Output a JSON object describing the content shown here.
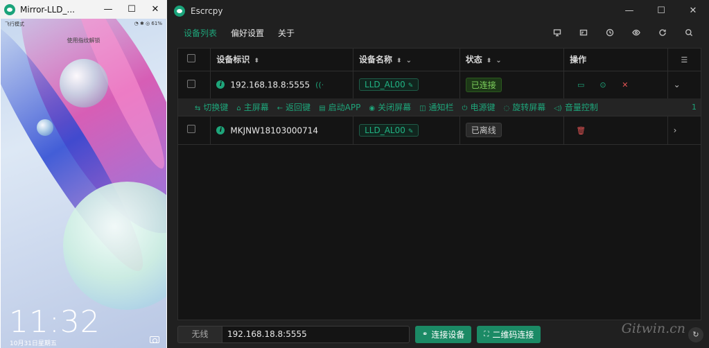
{
  "mirror": {
    "title": "Mirror-LLD_...",
    "status_left": "飞行模式",
    "status_right": "◔ ✱ ◎ 61%",
    "lock_hint": "使用指纹解锁",
    "clock": "11:32",
    "date": "10月31日星期五"
  },
  "app": {
    "title": "Escrcpy",
    "tabs": [
      "设备列表",
      "偏好设置",
      "关于"
    ],
    "toolbar_icons": [
      "presentation-icon",
      "cast-icon",
      "history-icon",
      "eye-icon",
      "refresh-icon",
      "search-icon"
    ],
    "accent": "#1ea57a"
  },
  "table": {
    "headers": {
      "id": "设备标识",
      "name": "设备名称",
      "status": "状态",
      "actions": "操作"
    },
    "rows": [
      {
        "id": "192.168.18.8:5555",
        "name": "LLD_AL00",
        "status": "已连接",
        "wireless": true
      },
      {
        "id": "MKJNW18103000714",
        "name": "LLD_AL00",
        "status": "已离线",
        "wireless": false
      }
    ]
  },
  "controls": {
    "items": [
      "切换键",
      "主屏幕",
      "返回键",
      "启动APP",
      "关闭屏幕",
      "通知栏",
      "电源键",
      "旋转屏幕",
      "音量控制"
    ],
    "page": "1"
  },
  "bottom": {
    "prefix": "无线",
    "ip_value": "192.168.18.8:5555",
    "connect_label": "连接设备",
    "qr_label": "二维码连接"
  },
  "watermark": "Gitwin.cn"
}
